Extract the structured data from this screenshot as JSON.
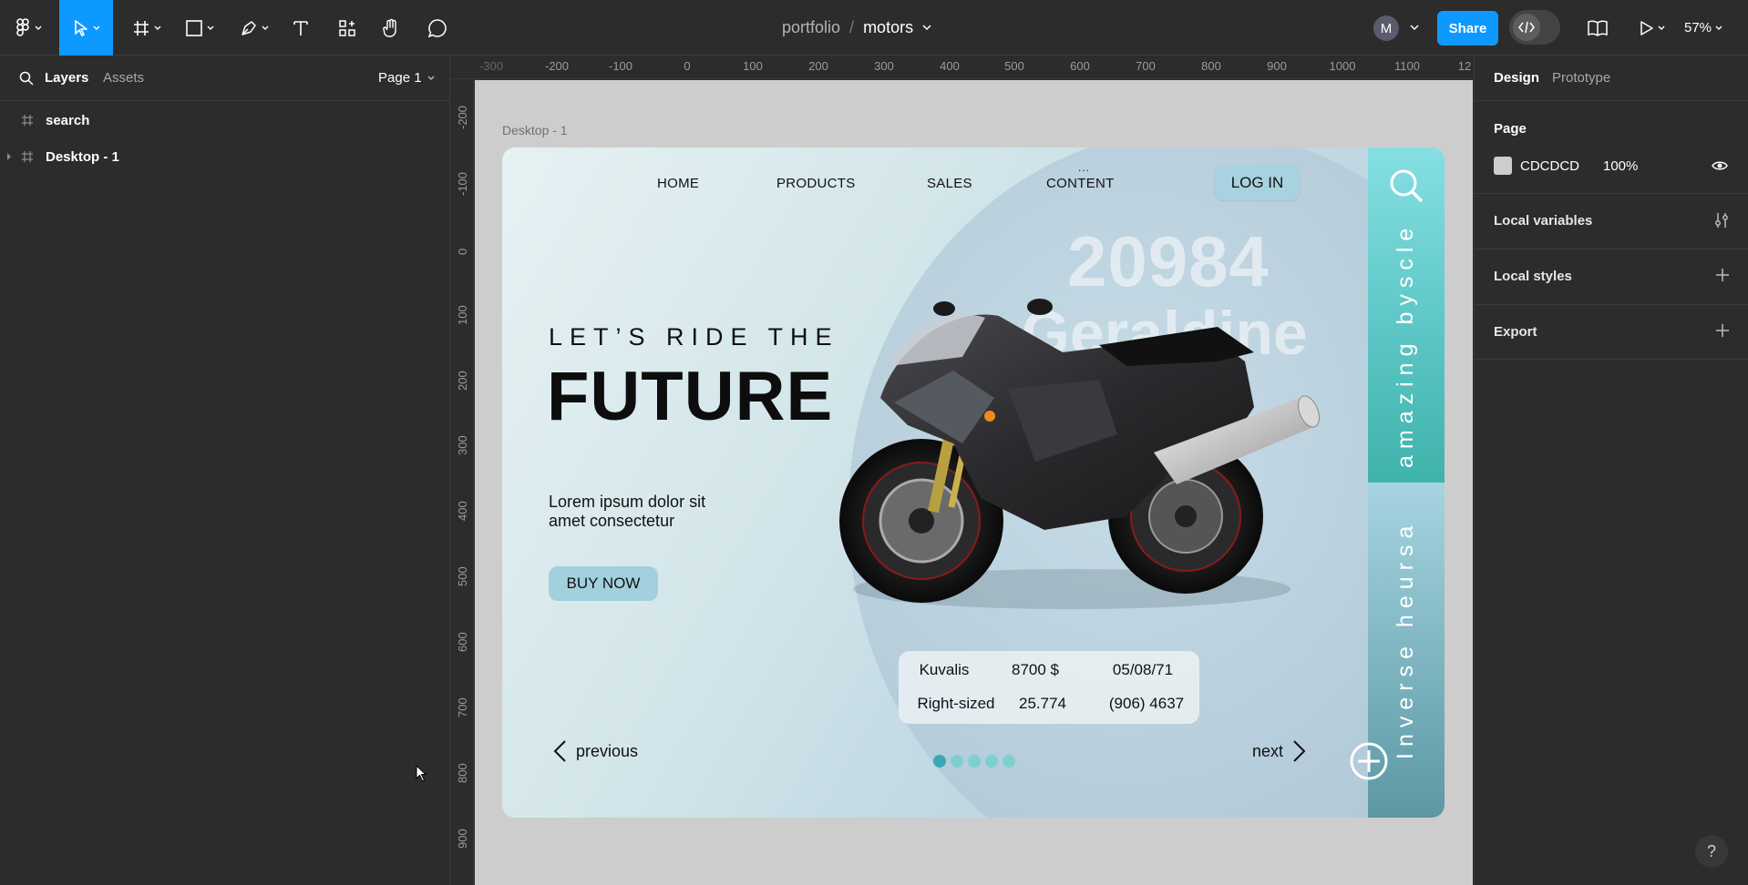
{
  "toolbar": {
    "breadcrumb_project": "portfolio",
    "breadcrumb_separator": "/",
    "file_name": "motors",
    "avatar_initial": "M",
    "share_label": "Share",
    "zoom": "57%"
  },
  "left_panel": {
    "tab_layers": "Layers",
    "tab_assets": "Assets",
    "page_select": "Page 1",
    "layers": [
      {
        "name": "search"
      },
      {
        "name": "Desktop - 1"
      }
    ]
  },
  "rulers": {
    "top": [
      "-300",
      "-200",
      "-100",
      "0",
      "100",
      "200",
      "300",
      "400",
      "500",
      "600",
      "700",
      "800",
      "900",
      "1000",
      "1100",
      "12"
    ],
    "left": [
      "-200",
      "-100",
      "0",
      "100",
      "200",
      "300",
      "400",
      "500",
      "600",
      "700",
      "800",
      "900"
    ]
  },
  "canvas": {
    "background": "#CDCDCD",
    "frame_label": "Desktop - 1"
  },
  "design": {
    "nav": [
      "HOME",
      "PRODUCTS",
      "SALES",
      "CONTENT"
    ],
    "nav_dots": "...",
    "login": "LOG IN",
    "big_number": "20984",
    "big_name": "Geraldine",
    "subhead": "LET’S RIDE THE",
    "headline": "FUTURE",
    "lorem": "Lorem ipsum dolor sit\n amet consectetur",
    "buy": "BUY NOW",
    "side_top": "amazing byscle",
    "side_bottom": "Inverse heursa",
    "info": {
      "row1": [
        "Kuvalis",
        "8700 $",
        "05/08/71"
      ],
      "row2": [
        "Right-sized",
        "25.774",
        "(906) 4637"
      ]
    },
    "prev": "previous",
    "next": "next",
    "dots_count": 5,
    "accent": "#38A9B2"
  },
  "right_panel": {
    "tab_design": "Design",
    "tab_prototype": "Prototype",
    "page_title": "Page",
    "page_color_hex": "CDCDCD",
    "page_color_opacity": "100%",
    "sections": [
      "Local variables",
      "Local styles",
      "Export"
    ]
  },
  "help": "?"
}
